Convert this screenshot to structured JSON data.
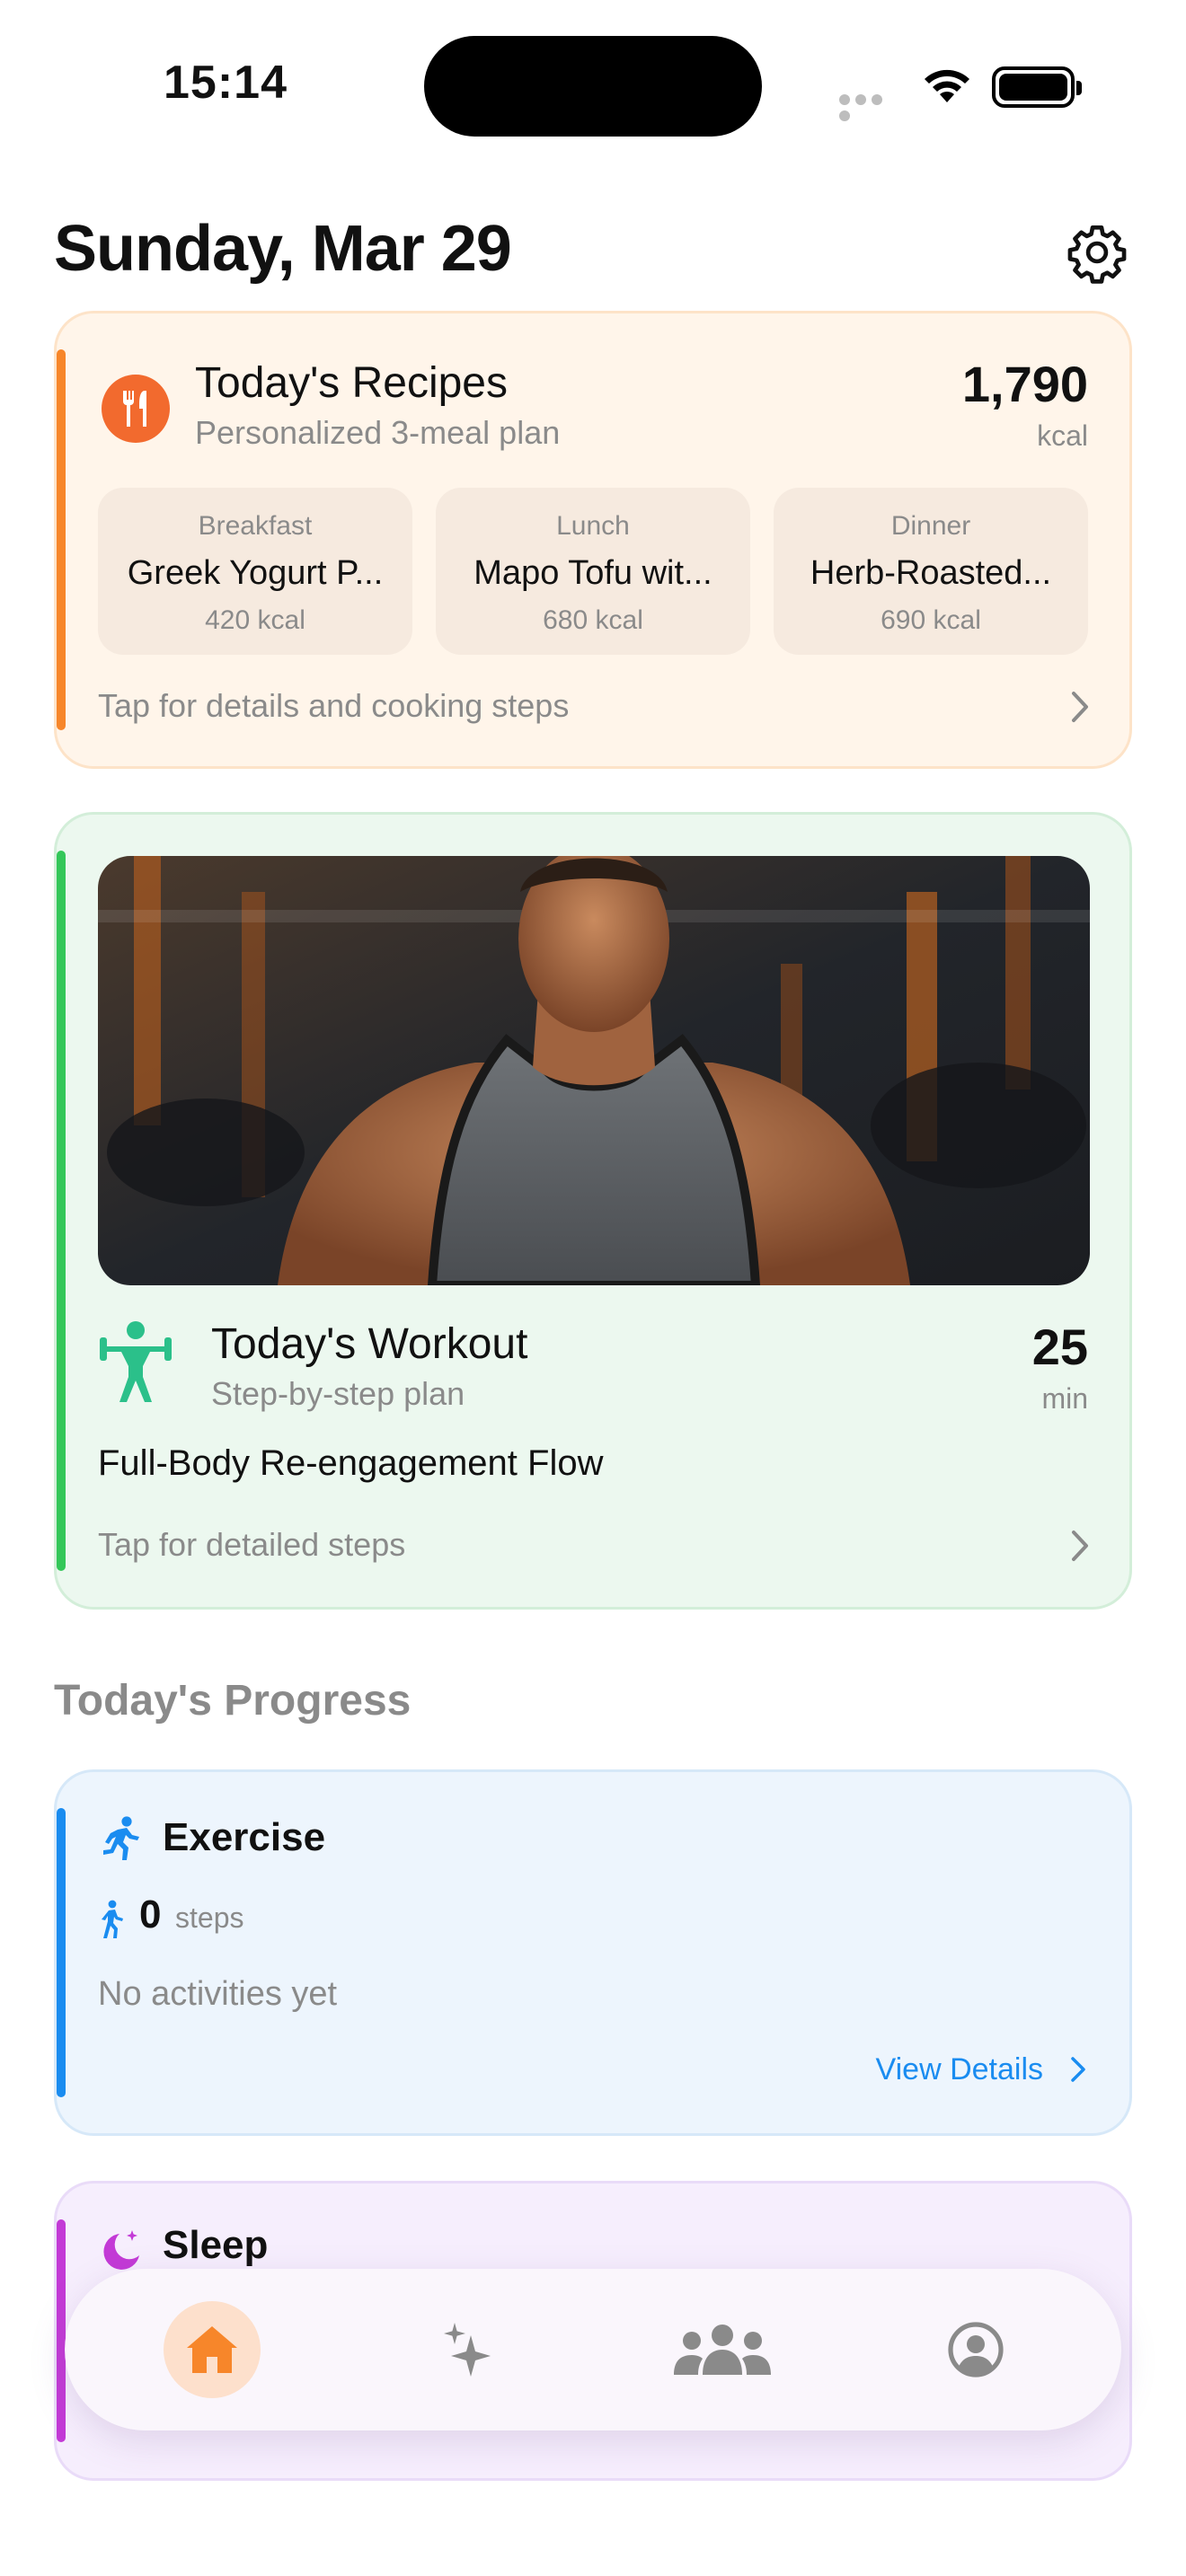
{
  "status_bar": {
    "time": "15:14"
  },
  "header": {
    "date": "Sunday, Mar 29"
  },
  "recipes": {
    "title": "Today's Recipes",
    "subtitle": "Personalized 3-meal plan",
    "calories": "1,790",
    "calories_unit": "kcal",
    "meals": [
      {
        "label": "Breakfast",
        "name": "Greek Yogurt P...",
        "kcal": "420 kcal"
      },
      {
        "label": "Lunch",
        "name": "Mapo Tofu wit...",
        "kcal": "680 kcal"
      },
      {
        "label": "Dinner",
        "name": "Herb-Roasted...",
        "kcal": "690 kcal"
      }
    ],
    "hint": "Tap for details and cooking steps",
    "accent": "#f7862a"
  },
  "workout": {
    "title": "Today's Workout",
    "subtitle": "Step-by-step plan",
    "duration": "25",
    "duration_unit": "min",
    "name": "Full-Body Re-engagement Flow",
    "hint": "Tap for detailed steps",
    "accent": "#34c759"
  },
  "progress": {
    "section_title": "Today's Progress",
    "exercise": {
      "title": "Exercise",
      "steps_value": "0",
      "steps_unit": "steps",
      "empty_text": "No activities yet",
      "link": "View Details",
      "accent": "#1a8cf0"
    },
    "sleep": {
      "title": "Sleep",
      "accent": "#c33ad6"
    }
  },
  "tab_bar": {
    "items": [
      {
        "icon": "home-icon",
        "active": true
      },
      {
        "icon": "sparkles-icon",
        "active": false
      },
      {
        "icon": "community-icon",
        "active": false
      },
      {
        "icon": "profile-icon",
        "active": false
      }
    ],
    "active_color": "#f7862a"
  }
}
